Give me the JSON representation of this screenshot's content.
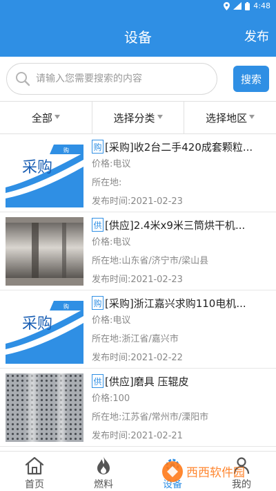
{
  "status": {
    "time": "4:48"
  },
  "header": {
    "title": "设备",
    "action": "发布"
  },
  "search": {
    "placeholder": "请输入您需要搜索的内容",
    "button": "搜索"
  },
  "filters": [
    {
      "label": "全部"
    },
    {
      "label": "选择分类"
    },
    {
      "label": "选择地区"
    }
  ],
  "labels": {
    "price": "价格:",
    "location": "所在地:",
    "time": "发布时间:"
  },
  "thumb_text": "采购",
  "items": [
    {
      "tag": "购",
      "title": "[采购]收2台二手420成套颗粒...",
      "price": "电议",
      "location": "",
      "time": "2021-02-23",
      "thumb": "purchase"
    },
    {
      "tag": "供",
      "title": "[供应]2.4米x9米三筒烘干机...",
      "price": "电议",
      "location": "山东省/济宁市/梁山县",
      "time": "2021-02-23",
      "thumb": "dryer"
    },
    {
      "tag": "购",
      "title": "[采购]浙江嘉兴求购110电机...",
      "price": "电议",
      "location": "浙江省/嘉兴市",
      "time": "2021-02-22",
      "thumb": "purchase"
    },
    {
      "tag": "供",
      "title": "[供应]磨具 压辊皮",
      "price": "100",
      "location": "江苏省/常州市/溧阳市",
      "time": "2021-02-21",
      "thumb": "roller"
    }
  ],
  "tabs": [
    {
      "label": "首页",
      "icon": "home-icon"
    },
    {
      "label": "燃料",
      "icon": "flame-icon"
    },
    {
      "label": "设备",
      "icon": "equipment-icon",
      "active": true
    },
    {
      "label": "我的",
      "icon": "user-icon"
    }
  ],
  "watermark": "西西软件园",
  "colors": {
    "primary": "#2f8fe4",
    "text": "#222222",
    "muted": "#888888"
  }
}
